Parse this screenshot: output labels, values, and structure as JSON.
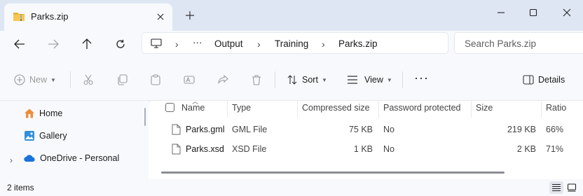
{
  "tab": {
    "title": "Parks.zip",
    "icon": "folder-zip-icon"
  },
  "window_controls": {
    "minimize": "—",
    "maximize": "☐",
    "close": "✕"
  },
  "breadcrumb": {
    "ellipsis": "···",
    "items": [
      "Output",
      "Training",
      "Parks.zip"
    ],
    "separator": "›"
  },
  "search": {
    "placeholder": "Search Parks.zip"
  },
  "commands": {
    "new": "New",
    "sort": "Sort",
    "view": "View",
    "more": "···",
    "details": "Details"
  },
  "sidebar": {
    "items": [
      {
        "label": "Home",
        "icon": "home-icon"
      },
      {
        "label": "Gallery",
        "icon": "gallery-icon"
      },
      {
        "label": "OneDrive - Personal",
        "icon": "cloud-icon"
      }
    ]
  },
  "columns": [
    "Name",
    "Type",
    "Compressed size",
    "Password protected",
    "Size",
    "Ratio"
  ],
  "files": [
    {
      "name": "Parks.gml",
      "type": "GML File",
      "compressed": "75 KB",
      "password": "No",
      "size": "219 KB",
      "ratio": "66%"
    },
    {
      "name": "Parks.xsd",
      "type": "XSD File",
      "compressed": "1 KB",
      "password": "No",
      "size": "2 KB",
      "ratio": "71%"
    }
  ],
  "status": {
    "item_count": "2 items"
  },
  "colors": {
    "accent": "#0067c0",
    "folder": "#e8b43a",
    "titlebar": "#dfe6f3",
    "pane": "#f8f9fc"
  }
}
